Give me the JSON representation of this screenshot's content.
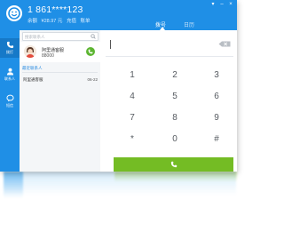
{
  "header": {
    "phone_number": "1 861****123",
    "meta": [
      "余额",
      "¥28.97 元",
      "充值",
      "账单"
    ]
  },
  "tabs": {
    "dial": "拨号",
    "log": "日历"
  },
  "nav": [
    {
      "label": "拨打",
      "icon": "phone-icon"
    },
    {
      "label": "联系人",
      "icon": "person-icon"
    },
    {
      "label": "短信",
      "icon": "chat-icon"
    }
  ],
  "contacts": {
    "search_placeholder": "搜索联系人",
    "card": {
      "name": "阿里通客服",
      "phone": "88000"
    },
    "recent_link": "最近联系人",
    "recent": [
      {
        "name": "阿里通客服",
        "date": "06-22"
      }
    ]
  },
  "dialpad": {
    "number_value": "",
    "keys": [
      "1",
      "2",
      "3",
      "4",
      "5",
      "6",
      "7",
      "8",
      "9",
      "*",
      "0",
      "#"
    ]
  },
  "colors": {
    "brand_blue": "#1f8fe6",
    "call_green": "#74bc24"
  }
}
